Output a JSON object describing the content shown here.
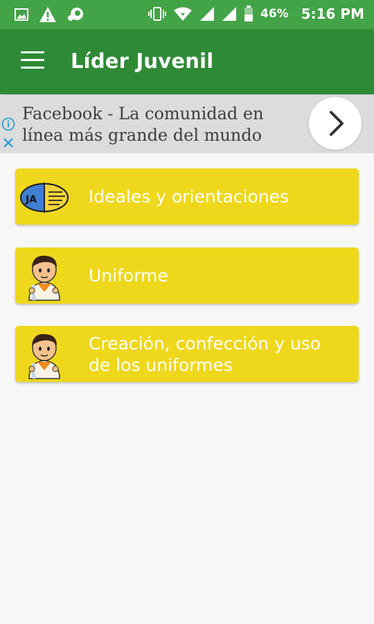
{
  "status_bar": {
    "battery": "46%",
    "time": "5:16 PM"
  },
  "app_bar": {
    "title": "Líder Juvenil"
  },
  "ad": {
    "text": "Facebook - La comunidad en línea más grande del mundo"
  },
  "cards": [
    {
      "label": "Ideales y orientaciones",
      "image": "ja-logo"
    },
    {
      "label": "Uniforme",
      "image": "pathfinder-boy"
    },
    {
      "label": "Creación, confección y uso de los uniformes",
      "image": "pathfinder-boy"
    }
  ],
  "colors": {
    "status_bar": "#43a347",
    "app_bar": "#2f8a36",
    "card": "#efd81b",
    "ad_bg": "#dcdcdc",
    "ad_info": "#1a9ad6"
  }
}
